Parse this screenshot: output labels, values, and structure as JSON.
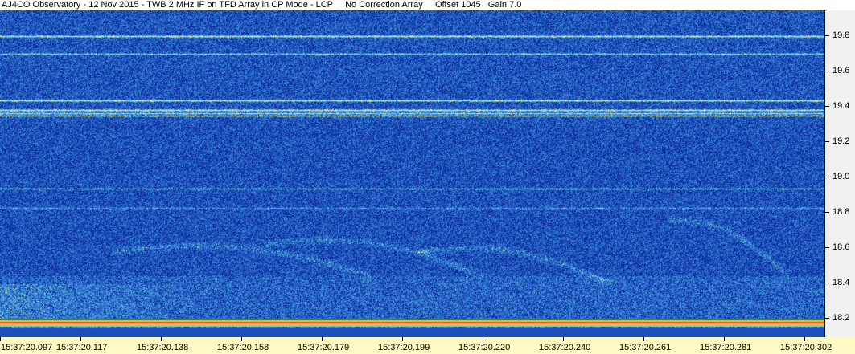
{
  "title": "AJ4CO Observatory - 12 Nov 2015 - TWB 2 MHz IF on TFD Array in CP Mode - LCP     No Correction Array     Offset 1045   Gain 7.0",
  "chart_data": {
    "type": "heatmap",
    "title": "AJ4CO Observatory - 12 Nov 2015 - TWB 2 MHz IF on TFD Array in CP Mode - LCP     No Correction Array     Offset 1045   Gain 7.0",
    "xlabel": "",
    "ylabel": "",
    "x_ticks": [
      "15:37:20.097",
      "15:37:20.117",
      "15:37:20.138",
      "15:37:20.158",
      "15:37:20.179",
      "15:37:20.199",
      "15:37:20.220",
      "15:37:20.240",
      "15:37:20.261",
      "15:37:20.281",
      "15:37:20.302"
    ],
    "y_ticks": [
      "19.8",
      "19.6",
      "19.4",
      "19.2",
      "19.0",
      "18.8",
      "18.6",
      "18.4",
      "18.2"
    ],
    "y_tick_values": [
      19.8,
      19.6,
      19.4,
      19.2,
      19.0,
      18.8,
      18.6,
      18.4,
      18.2
    ],
    "ylim": [
      18.09,
      19.94
    ],
    "colors": {
      "background": "#1d4fb8",
      "noise_low": "#0f2f8f",
      "noise_high": "#3a7bd8",
      "emission": "#6fd3e0",
      "hot": "#ffd23a",
      "axis_panel": "#f1f1f1",
      "time_panel": "#fff9c4"
    }
  }
}
